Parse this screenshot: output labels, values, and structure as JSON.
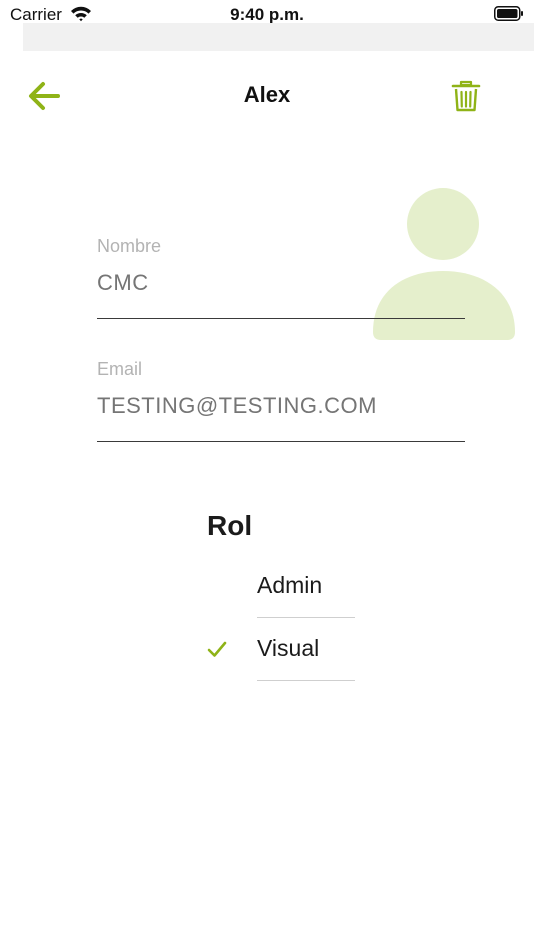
{
  "status_bar": {
    "carrier": "Carrier",
    "time": "9:40 p.m.",
    "icons": [
      "wifi-icon",
      "battery-icon"
    ]
  },
  "nav": {
    "title": "Alex",
    "back_icon": "arrow-left-icon",
    "delete_icon": "trash-icon"
  },
  "colors": {
    "accent": "#8fb317",
    "avatar": "#e5efcc",
    "label": "#b3b3b3",
    "input_text": "#c4c4c4"
  },
  "form": {
    "name": {
      "label": "Nombre",
      "placeholder": "CMC"
    },
    "email": {
      "label": "Email",
      "placeholder": "TESTING@TESTING.COM"
    }
  },
  "role": {
    "title": "Rol",
    "options": [
      {
        "label": "Admin",
        "selected": false
      },
      {
        "label": "Visual",
        "selected": true
      }
    ]
  }
}
